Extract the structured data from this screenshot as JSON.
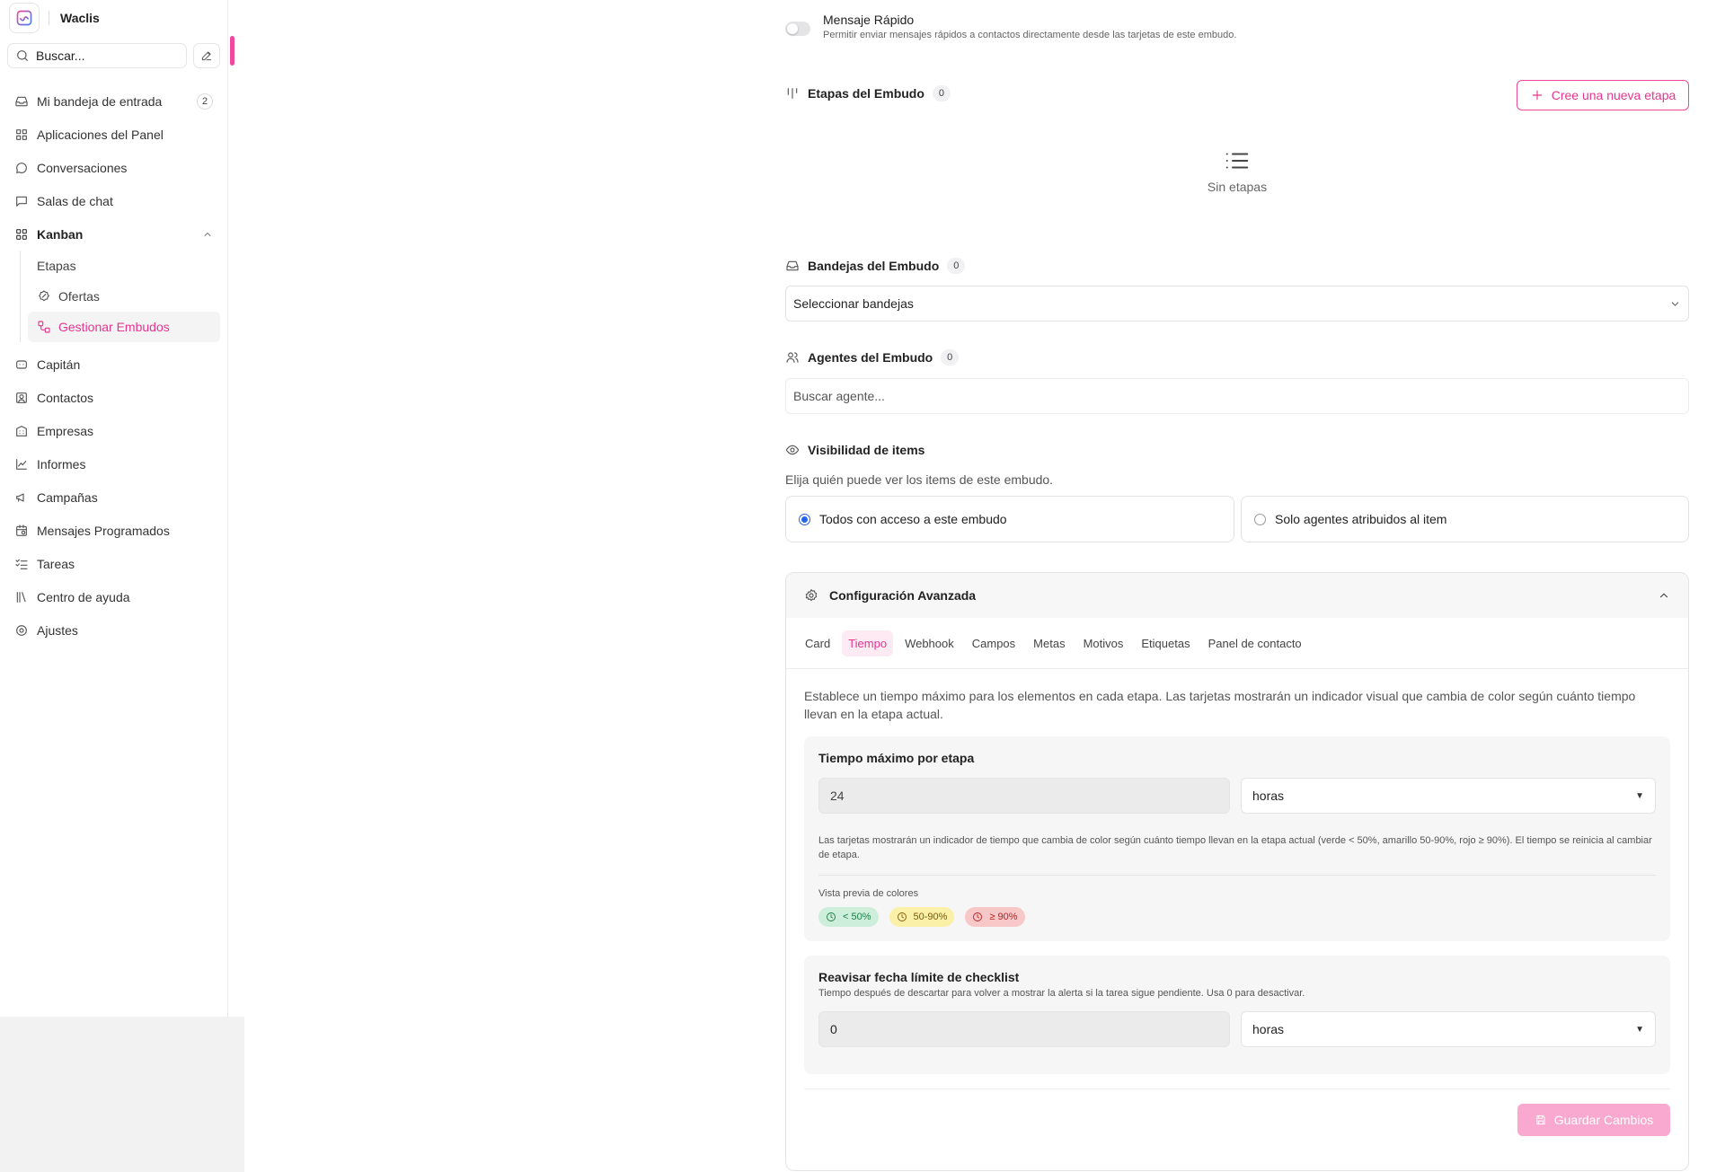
{
  "sidebar": {
    "brand": "Waclis",
    "search_label": "Buscar...",
    "items_top": [
      {
        "label": "Mi bandeja de entrada",
        "icon": "inbox-icon",
        "badge": "2"
      },
      {
        "label": "Aplicaciones del Panel",
        "icon": "grid-icon"
      },
      {
        "label": "Conversaciones",
        "icon": "chat-bubble-icon"
      },
      {
        "label": "Salas de chat",
        "icon": "message-square-icon"
      },
      {
        "label": "Kanban",
        "icon": "kanban-icon"
      }
    ],
    "kanban_sub": [
      {
        "label": "Etapas"
      },
      {
        "label": "Ofertas",
        "icon": "badge-percent-icon"
      },
      {
        "label": "Gestionar Embudos",
        "icon": "workflow-icon",
        "active": true
      }
    ],
    "items_bottom": [
      {
        "label": "Capitán",
        "icon": "bot-icon"
      },
      {
        "label": "Contactos",
        "icon": "contact-icon"
      },
      {
        "label": "Empresas",
        "icon": "building-icon"
      },
      {
        "label": "Informes",
        "icon": "chart-line-icon"
      },
      {
        "label": "Campañas",
        "icon": "megaphone-icon"
      },
      {
        "label": "Mensajes Programados",
        "icon": "calendar-clock-icon"
      },
      {
        "label": "Tareas",
        "icon": "list-checks-icon"
      },
      {
        "label": "Centro de ayuda",
        "icon": "library-icon"
      },
      {
        "label": "Ajustes",
        "icon": "settings-icon"
      }
    ]
  },
  "main": {
    "quick_message": {
      "title": "Mensaje Rápido",
      "description": "Permitir enviar mensajes rápidos a contactos directamente desde las tarjetas de este embudo.",
      "enabled": false
    },
    "stages": {
      "title": "Etapas del Embudo",
      "count": "0",
      "new_button": "Cree una nueva etapa",
      "empty_text": "Sin etapas"
    },
    "inboxes": {
      "title": "Bandejas del Embudo",
      "count": "0",
      "select_placeholder": "Seleccionar bandejas"
    },
    "agents": {
      "title": "Agentes del Embudo",
      "count": "0",
      "search_placeholder": "Buscar agente..."
    },
    "visibility": {
      "title": "Visibilidad de items",
      "description": "Elija quién puede ver los items de este embudo.",
      "options": [
        {
          "label": "Todos con acceso a este embudo",
          "selected": true
        },
        {
          "label": "Solo agentes atribuidos al item",
          "selected": false
        }
      ]
    },
    "advanced": {
      "title": "Configuración Avanzada",
      "tabs": [
        "Card",
        "Tiempo",
        "Webhook",
        "Campos",
        "Metas",
        "Motivos",
        "Etiquetas",
        "Panel de contacto"
      ],
      "active_tab": "Tiempo",
      "description": "Establece un tiempo máximo para los elementos en cada etapa. Las tarjetas mostrarán un indicador visual que cambia de color según cuánto tiempo llevan en la etapa actual.",
      "max_time": {
        "title": "Tiempo máximo por etapa",
        "value": "24",
        "unit": "horas",
        "hint": "Las tarjetas mostrarán un indicador de tiempo que cambia de color según cuánto tiempo llevan en la etapa actual (verde < 50%, amarillo 50-90%, rojo ≥ 90%). El tiempo se reinicia al cambiar de etapa.",
        "preview_label": "Vista previa de colores",
        "chips": [
          {
            "label": "< 50%",
            "bg": "#cdeedb",
            "fg": "#1e7a45"
          },
          {
            "label": "50-90%",
            "bg": "#fbf0a8",
            "fg": "#7a5a08"
          },
          {
            "label": "≥ 90%",
            "bg": "#f8c7c7",
            "fg": "#b42323"
          }
        ]
      },
      "checklist": {
        "title": "Reavisar fecha límite de checklist",
        "description": "Tiempo después de descartar para volver a mostrar la alerta si la tarea sigue pendiente. Usa 0 para desactivar.",
        "value": "0",
        "unit": "horas"
      },
      "save_button": "Guardar Cambios"
    }
  },
  "colors": {
    "accent": "#e5368f",
    "accent_light": "#f9a8cf",
    "radio": "#2563eb"
  }
}
